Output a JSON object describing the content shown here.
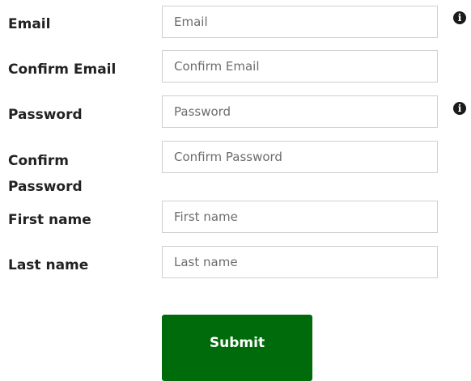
{
  "form": {
    "fields": [
      {
        "label": "Email",
        "placeholder": "Email",
        "value": "",
        "info": true
      },
      {
        "label": "Confirm Email",
        "placeholder": "Confirm Email",
        "value": "",
        "info": false
      },
      {
        "label": "Password",
        "placeholder": "Password",
        "value": "",
        "info": true
      },
      {
        "label": "Confirm Password",
        "placeholder": "Confirm Password",
        "value": "",
        "info": false
      },
      {
        "label": "First name",
        "placeholder": "First name",
        "value": "",
        "info": false
      },
      {
        "label": "Last name",
        "placeholder": "Last name",
        "value": "",
        "info": false
      }
    ],
    "info_icon_glyph": "i",
    "info_icon_name": "info-icon",
    "submit_label": "Submit"
  },
  "colors": {
    "submit_background": "#006b0a",
    "submit_text": "#ffffff",
    "label_text": "#222222",
    "input_border": "#cfcfcf",
    "placeholder_text": "#6c6c6c",
    "info_icon": "#1a1a1a"
  }
}
